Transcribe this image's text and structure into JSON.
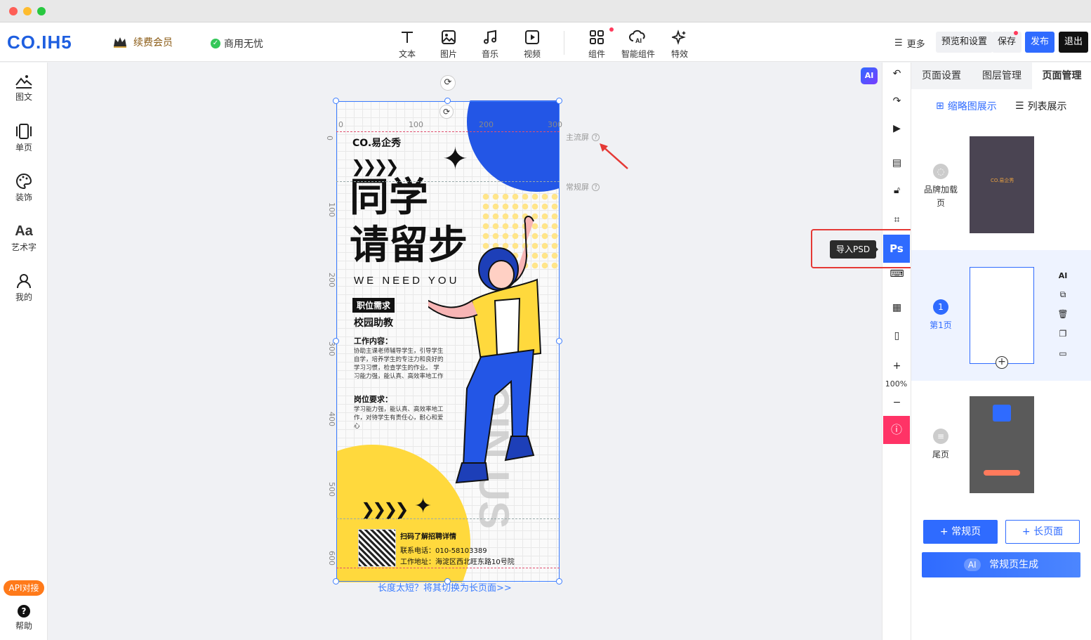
{
  "topbar": {
    "logo": "CO.IH5",
    "vip_label": "续费会员",
    "commercial_label": "商用无忧",
    "tools": [
      {
        "label": "文本",
        "icon": "text-icon"
      },
      {
        "label": "图片",
        "icon": "image-icon"
      },
      {
        "label": "音乐",
        "icon": "music-icon"
      },
      {
        "label": "视频",
        "icon": "video-icon"
      },
      {
        "label": "组件",
        "icon": "component-icon"
      },
      {
        "label": "智能组件",
        "icon": "ai-component-icon"
      },
      {
        "label": "特效",
        "icon": "sparkle-icon"
      }
    ],
    "more_label": "更多",
    "preview_label": "预览和设置",
    "save_label": "保存",
    "publish_label": "发布",
    "exit_label": "退出"
  },
  "leftbar": {
    "items": [
      {
        "label": "图文",
        "icon": "image-text-icon"
      },
      {
        "label": "单页",
        "icon": "single-page-icon"
      },
      {
        "label": "装饰",
        "icon": "palette-icon"
      },
      {
        "label": "艺术字",
        "icon": "art-text-icon"
      },
      {
        "label": "我的",
        "icon": "user-icon"
      }
    ],
    "api_label": "API对接",
    "help_label": "帮助"
  },
  "canvas": {
    "ai_label": "AI",
    "mainstream_label": "主流屏",
    "regular_label": "常规屏",
    "ruler_top": [
      "0",
      "100",
      "200",
      "300"
    ],
    "ruler_left": [
      "0",
      "100",
      "200",
      "300",
      "400",
      "500",
      "600"
    ],
    "long_page_link": "长度太短？将其切换为长页面>>"
  },
  "poster": {
    "brand": "CO.易企秀",
    "arrows": "❯❯❯❯",
    "title1": "同学",
    "title2": "请留步",
    "subtitle": "WE NEED YOU",
    "tag": "职位需求",
    "role": "校园助教",
    "work_heading": "工作内容：",
    "work_body": "协助主课老师辅导学生，引导学生自学，培养学生的专注力和良好的学习习惯，检查学生的作业。 学习能力强，能认真、高效率地工作",
    "req_heading": "岗位要求：",
    "req_body": "学习能力强，能认真、高效率地工作，对待学生有责任心，耐心和爱心",
    "scan_label": "扫码了解招聘详情",
    "phone": "联系电话：010-58103389",
    "address": "工作地址：海淀区西北旺东路10号院",
    "vertical_text": "JOIN US"
  },
  "right_toolbar": {
    "ps_label": "Ps",
    "tooltip": "导入PSD",
    "zoom": "100%"
  },
  "right_panel": {
    "tabs": [
      "页面设置",
      "图层管理",
      "页面管理"
    ],
    "active_tab": "页面管理",
    "view_thumbnail": "缩略图展示",
    "view_list": "列表展示",
    "pages": [
      {
        "label": "品牌加载页",
        "badge": ""
      },
      {
        "label": "第1页",
        "badge": "1"
      },
      {
        "label": "尾页",
        "badge": ""
      }
    ],
    "actions": [
      "AI"
    ],
    "add_normal": "+ 常规页",
    "add_long": "+ 长页面",
    "ai_chip": "AI",
    "ai_generate": "常规页生成"
  },
  "colors": {
    "accent": "#2f6bff",
    "poster_blue": "#2356e6",
    "poster_yellow": "#ffd93d",
    "alert": "#ff3366"
  }
}
